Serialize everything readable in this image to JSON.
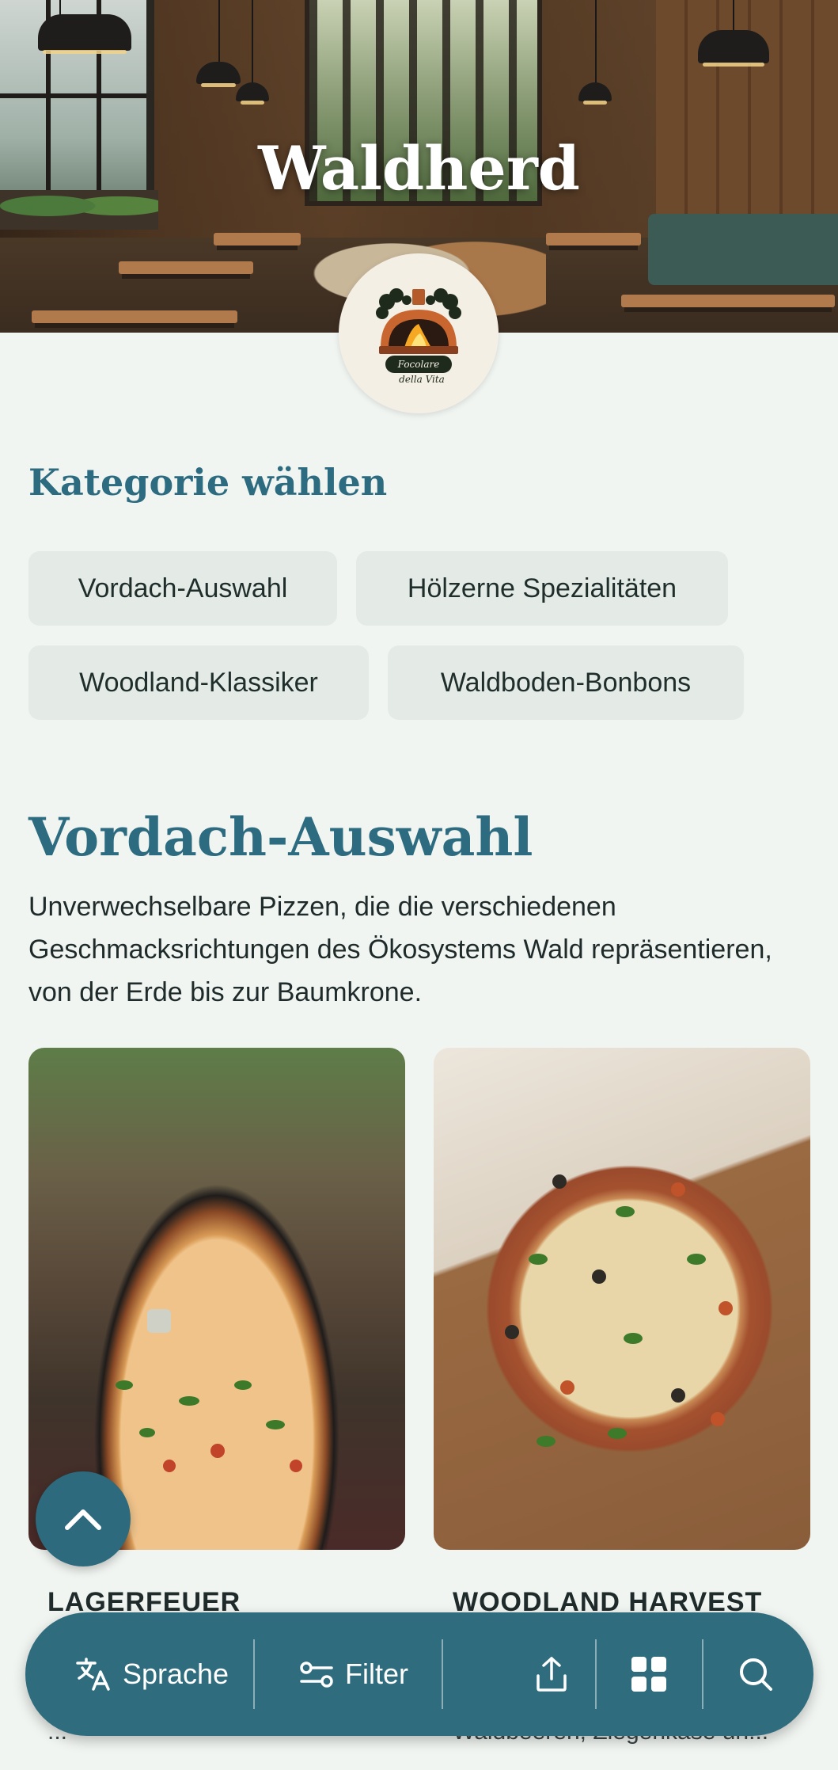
{
  "hero": {
    "title": "Waldherd",
    "logo_text_line1": "Focolare",
    "logo_text_line2": "della Vita"
  },
  "categories": {
    "heading": "Kategorie wählen",
    "chips": [
      "Vordach-Auswahl",
      "Hölzerne Spezialitäten",
      "Woodland-Klassiker",
      "Waldboden-Bonbons"
    ]
  },
  "section": {
    "title": "Vordach-Auswahl",
    "description": "Unverwechselbare Pizzen, die die verschiedenen Geschmacksrichtungen des Ökosystems Wald repräsentieren, von der Erde bis zur Baumkrone."
  },
  "cards": [
    {
      "title": "LAGERFEUER",
      "subtitle": "...",
      "image": "campfire-pizza-photo"
    },
    {
      "title": "WOODLAND HARVEST",
      "subtitle": "Waldbeeren, Ziegenkäse un...",
      "image": "woodland-harvest-pizza-photo"
    }
  ],
  "bottom_bar": {
    "language_label": "Sprache",
    "filter_label": "Filter",
    "icons": [
      "translate-icon",
      "filter-icon",
      "share-icon",
      "grid-icon",
      "search-icon"
    ]
  },
  "colors": {
    "accent": "#2f6c7e",
    "heading": "#2c6b80",
    "background": "#f1f5f1",
    "chip": "#e4ebe7"
  }
}
